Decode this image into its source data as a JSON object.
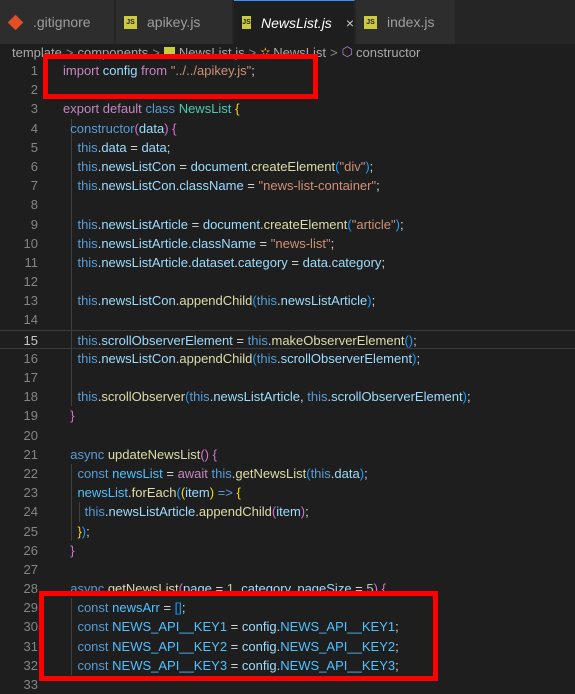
{
  "tabs": [
    {
      "label": ".gitignore",
      "icon": "git-icon"
    },
    {
      "label": "apikey.js",
      "icon": "js-icon"
    },
    {
      "label": "NewsList.js",
      "icon": "js-icon",
      "active": true
    },
    {
      "label": "index.js",
      "icon": "js-icon"
    }
  ],
  "tab_close": "×",
  "js_icon_text": "JS",
  "breadcrumb": [
    "template",
    "components",
    "NewsList.js",
    "NewsList",
    "constructor"
  ],
  "breadcrumb_sep": ">",
  "line_numbers": [
    "1",
    "2",
    "3",
    "4",
    "5",
    "6",
    "7",
    "8",
    "9",
    "10",
    "11",
    "12",
    "13",
    "14",
    "15",
    "16",
    "17",
    "18",
    "19",
    "20",
    "21",
    "22",
    "23",
    "24",
    "25",
    "26",
    "27",
    "28",
    "29",
    "30",
    "31",
    "32",
    "33"
  ],
  "current_line": "15",
  "highlight_color": "#ff0000",
  "lines": [
    {
      "n": "1",
      "tokens": [
        [
          "ctrl",
          "import"
        ],
        [
          "txt",
          " "
        ],
        [
          "var",
          "config"
        ],
        [
          "txt",
          " "
        ],
        [
          "ctrl",
          "from"
        ],
        [
          "txt",
          " "
        ],
        [
          "str",
          "\"../../apikey.js\""
        ],
        [
          "txt",
          ";"
        ]
      ]
    },
    {
      "n": "2",
      "tokens": []
    },
    {
      "n": "3",
      "tokens": [
        [
          "ctrl",
          "export"
        ],
        [
          "txt",
          " "
        ],
        [
          "ctrl",
          "default"
        ],
        [
          "txt",
          " "
        ],
        [
          "kw",
          "class"
        ],
        [
          "txt",
          " "
        ],
        [
          "cls",
          "NewsList"
        ],
        [
          "txt",
          " "
        ],
        [
          "br",
          "{"
        ]
      ]
    },
    {
      "n": "4",
      "tokens": [
        [
          "txt",
          "  "
        ],
        [
          "kw",
          "constructor"
        ],
        [
          "br2",
          "("
        ],
        [
          "var",
          "data"
        ],
        [
          "br2",
          ")"
        ],
        [
          "txt",
          " "
        ],
        [
          "br2",
          "{"
        ]
      ]
    },
    {
      "n": "5",
      "tokens": [
        [
          "txt",
          "    "
        ],
        [
          "kw",
          "this"
        ],
        [
          "txt",
          "."
        ],
        [
          "var",
          "data"
        ],
        [
          "txt",
          " = "
        ],
        [
          "var",
          "data"
        ],
        [
          "txt",
          ";"
        ]
      ]
    },
    {
      "n": "6",
      "tokens": [
        [
          "txt",
          "    "
        ],
        [
          "kw",
          "this"
        ],
        [
          "txt",
          "."
        ],
        [
          "var",
          "newsListCon"
        ],
        [
          "txt",
          " = "
        ],
        [
          "var",
          "document"
        ],
        [
          "txt",
          "."
        ],
        [
          "fn",
          "createElement"
        ],
        [
          "br3",
          "("
        ],
        [
          "str",
          "\"div\""
        ],
        [
          "br3",
          ")"
        ],
        [
          "txt",
          ";"
        ]
      ]
    },
    {
      "n": "7",
      "tokens": [
        [
          "txt",
          "    "
        ],
        [
          "kw",
          "this"
        ],
        [
          "txt",
          "."
        ],
        [
          "var",
          "newsListCon"
        ],
        [
          "txt",
          "."
        ],
        [
          "var",
          "className"
        ],
        [
          "txt",
          " = "
        ],
        [
          "str",
          "\"news-list-container\""
        ],
        [
          "txt",
          ";"
        ]
      ]
    },
    {
      "n": "8",
      "tokens": []
    },
    {
      "n": "9",
      "tokens": [
        [
          "txt",
          "    "
        ],
        [
          "kw",
          "this"
        ],
        [
          "txt",
          "."
        ],
        [
          "var",
          "newsListArticle"
        ],
        [
          "txt",
          " = "
        ],
        [
          "var",
          "document"
        ],
        [
          "txt",
          "."
        ],
        [
          "fn",
          "createElement"
        ],
        [
          "br3",
          "("
        ],
        [
          "str",
          "\"article\""
        ],
        [
          "br3",
          ")"
        ],
        [
          "txt",
          ";"
        ]
      ]
    },
    {
      "n": "10",
      "tokens": [
        [
          "txt",
          "    "
        ],
        [
          "kw",
          "this"
        ],
        [
          "txt",
          "."
        ],
        [
          "var",
          "newsListArticle"
        ],
        [
          "txt",
          "."
        ],
        [
          "var",
          "className"
        ],
        [
          "txt",
          " = "
        ],
        [
          "str",
          "\"news-list\""
        ],
        [
          "txt",
          ";"
        ]
      ]
    },
    {
      "n": "11",
      "tokens": [
        [
          "txt",
          "    "
        ],
        [
          "kw",
          "this"
        ],
        [
          "txt",
          "."
        ],
        [
          "var",
          "newsListArticle"
        ],
        [
          "txt",
          "."
        ],
        [
          "var",
          "dataset"
        ],
        [
          "txt",
          "."
        ],
        [
          "var",
          "category"
        ],
        [
          "txt",
          " = "
        ],
        [
          "var",
          "data"
        ],
        [
          "txt",
          "."
        ],
        [
          "var",
          "category"
        ],
        [
          "txt",
          ";"
        ]
      ]
    },
    {
      "n": "12",
      "tokens": []
    },
    {
      "n": "13",
      "tokens": [
        [
          "txt",
          "    "
        ],
        [
          "kw",
          "this"
        ],
        [
          "txt",
          "."
        ],
        [
          "var",
          "newsListCon"
        ],
        [
          "txt",
          "."
        ],
        [
          "fn",
          "appendChild"
        ],
        [
          "br3",
          "("
        ],
        [
          "kw",
          "this"
        ],
        [
          "txt",
          "."
        ],
        [
          "var",
          "newsListArticle"
        ],
        [
          "br3",
          ")"
        ],
        [
          "txt",
          ";"
        ]
      ]
    },
    {
      "n": "14",
      "tokens": []
    },
    {
      "n": "15",
      "tokens": [
        [
          "txt",
          "    "
        ],
        [
          "kw",
          "this"
        ],
        [
          "txt",
          "."
        ],
        [
          "var",
          "scrollObserverElement"
        ],
        [
          "txt",
          " = "
        ],
        [
          "kw",
          "this"
        ],
        [
          "txt",
          "."
        ],
        [
          "fn",
          "makeObserverElement"
        ],
        [
          "br3",
          "()"
        ],
        [
          "txt",
          ";"
        ]
      ]
    },
    {
      "n": "16",
      "tokens": [
        [
          "txt",
          "    "
        ],
        [
          "kw",
          "this"
        ],
        [
          "txt",
          "."
        ],
        [
          "var",
          "newsListCon"
        ],
        [
          "txt",
          "."
        ],
        [
          "fn",
          "appendChild"
        ],
        [
          "br3",
          "("
        ],
        [
          "kw",
          "this"
        ],
        [
          "txt",
          "."
        ],
        [
          "var",
          "scrollObserverElement"
        ],
        [
          "br3",
          ")"
        ],
        [
          "txt",
          ";"
        ]
      ]
    },
    {
      "n": "17",
      "tokens": []
    },
    {
      "n": "18",
      "tokens": [
        [
          "txt",
          "    "
        ],
        [
          "kw",
          "this"
        ],
        [
          "txt",
          "."
        ],
        [
          "fn",
          "scrollObserver"
        ],
        [
          "br3",
          "("
        ],
        [
          "kw",
          "this"
        ],
        [
          "txt",
          "."
        ],
        [
          "var",
          "newsListArticle"
        ],
        [
          "txt",
          ", "
        ],
        [
          "kw",
          "this"
        ],
        [
          "txt",
          "."
        ],
        [
          "var",
          "scrollObserverElement"
        ],
        [
          "br3",
          ")"
        ],
        [
          "txt",
          ";"
        ]
      ]
    },
    {
      "n": "19",
      "tokens": [
        [
          "txt",
          "  "
        ],
        [
          "br2",
          "}"
        ]
      ]
    },
    {
      "n": "20",
      "tokens": []
    },
    {
      "n": "21",
      "tokens": [
        [
          "txt",
          "  "
        ],
        [
          "kw",
          "async"
        ],
        [
          "txt",
          " "
        ],
        [
          "fn",
          "updateNewsList"
        ],
        [
          "br2",
          "()"
        ],
        [
          "txt",
          " "
        ],
        [
          "br2",
          "{"
        ]
      ]
    },
    {
      "n": "22",
      "tokens": [
        [
          "txt",
          "    "
        ],
        [
          "kw",
          "const"
        ],
        [
          "txt",
          " "
        ],
        [
          "const",
          "newsList"
        ],
        [
          "txt",
          " = "
        ],
        [
          "ctrl",
          "await"
        ],
        [
          "txt",
          " "
        ],
        [
          "kw",
          "this"
        ],
        [
          "txt",
          "."
        ],
        [
          "fn",
          "getNewsList"
        ],
        [
          "br3",
          "("
        ],
        [
          "kw",
          "this"
        ],
        [
          "txt",
          "."
        ],
        [
          "var",
          "data"
        ],
        [
          "br3",
          ")"
        ],
        [
          "txt",
          ";"
        ]
      ]
    },
    {
      "n": "23",
      "tokens": [
        [
          "txt",
          "    "
        ],
        [
          "const",
          "newsList"
        ],
        [
          "txt",
          "."
        ],
        [
          "fn",
          "forEach"
        ],
        [
          "br3",
          "("
        ],
        [
          "br",
          "("
        ],
        [
          "var",
          "item"
        ],
        [
          "br",
          ")"
        ],
        [
          "txt",
          " "
        ],
        [
          "kw",
          "=>"
        ],
        [
          "txt",
          " "
        ],
        [
          "br",
          "{"
        ]
      ]
    },
    {
      "n": "24",
      "tokens": [
        [
          "txt",
          "      "
        ],
        [
          "kw",
          "this"
        ],
        [
          "txt",
          "."
        ],
        [
          "var",
          "newsListArticle"
        ],
        [
          "txt",
          "."
        ],
        [
          "fn",
          "appendChild"
        ],
        [
          "br2",
          "("
        ],
        [
          "var",
          "item"
        ],
        [
          "br2",
          ")"
        ],
        [
          "txt",
          ";"
        ]
      ]
    },
    {
      "n": "25",
      "tokens": [
        [
          "txt",
          "    "
        ],
        [
          "br",
          "}"
        ],
        [
          "br3",
          ")"
        ],
        [
          "txt",
          ";"
        ]
      ]
    },
    {
      "n": "26",
      "tokens": [
        [
          "txt",
          "  "
        ],
        [
          "br2",
          "}"
        ]
      ]
    },
    {
      "n": "27",
      "tokens": []
    },
    {
      "n": "28",
      "tokens": [
        [
          "txt",
          "  "
        ],
        [
          "kw",
          "async"
        ],
        [
          "txt",
          " "
        ],
        [
          "fn",
          "getNewsList"
        ],
        [
          "br2",
          "("
        ],
        [
          "var",
          "page"
        ],
        [
          "txt",
          " = "
        ],
        [
          "num",
          "1"
        ],
        [
          "txt",
          ", "
        ],
        [
          "var",
          "category"
        ],
        [
          "txt",
          ", "
        ],
        [
          "var",
          "pageSize"
        ],
        [
          "txt",
          " = "
        ],
        [
          "num",
          "5"
        ],
        [
          "br2",
          ")"
        ],
        [
          "txt",
          " "
        ],
        [
          "br2",
          "{"
        ]
      ]
    },
    {
      "n": "29",
      "tokens": [
        [
          "txt",
          "    "
        ],
        [
          "kw",
          "const"
        ],
        [
          "txt",
          " "
        ],
        [
          "const",
          "newsArr"
        ],
        [
          "txt",
          " = "
        ],
        [
          "br3",
          "[]"
        ],
        [
          "txt",
          ";"
        ]
      ]
    },
    {
      "n": "30",
      "tokens": [
        [
          "txt",
          "    "
        ],
        [
          "kw",
          "const"
        ],
        [
          "txt",
          " "
        ],
        [
          "const",
          "NEWS_API__KEY1"
        ],
        [
          "txt",
          " = "
        ],
        [
          "var",
          "config"
        ],
        [
          "txt",
          "."
        ],
        [
          "const",
          "NEWS_API__KEY1"
        ],
        [
          "txt",
          ";"
        ]
      ]
    },
    {
      "n": "31",
      "tokens": [
        [
          "txt",
          "    "
        ],
        [
          "kw",
          "const"
        ],
        [
          "txt",
          " "
        ],
        [
          "const",
          "NEWS_API__KEY2"
        ],
        [
          "txt",
          " = "
        ],
        [
          "var",
          "config"
        ],
        [
          "txt",
          "."
        ],
        [
          "const",
          "NEWS_API__KEY2"
        ],
        [
          "txt",
          ";"
        ]
      ]
    },
    {
      "n": "32",
      "tokens": [
        [
          "txt",
          "    "
        ],
        [
          "kw",
          "const"
        ],
        [
          "txt",
          " "
        ],
        [
          "const",
          "NEWS_API__KEY3"
        ],
        [
          "txt",
          " = "
        ],
        [
          "var",
          "config"
        ],
        [
          "txt",
          "."
        ],
        [
          "const",
          "NEWS_API__KEY3"
        ],
        [
          "txt",
          ";"
        ]
      ]
    },
    {
      "n": "33",
      "tokens": []
    }
  ]
}
